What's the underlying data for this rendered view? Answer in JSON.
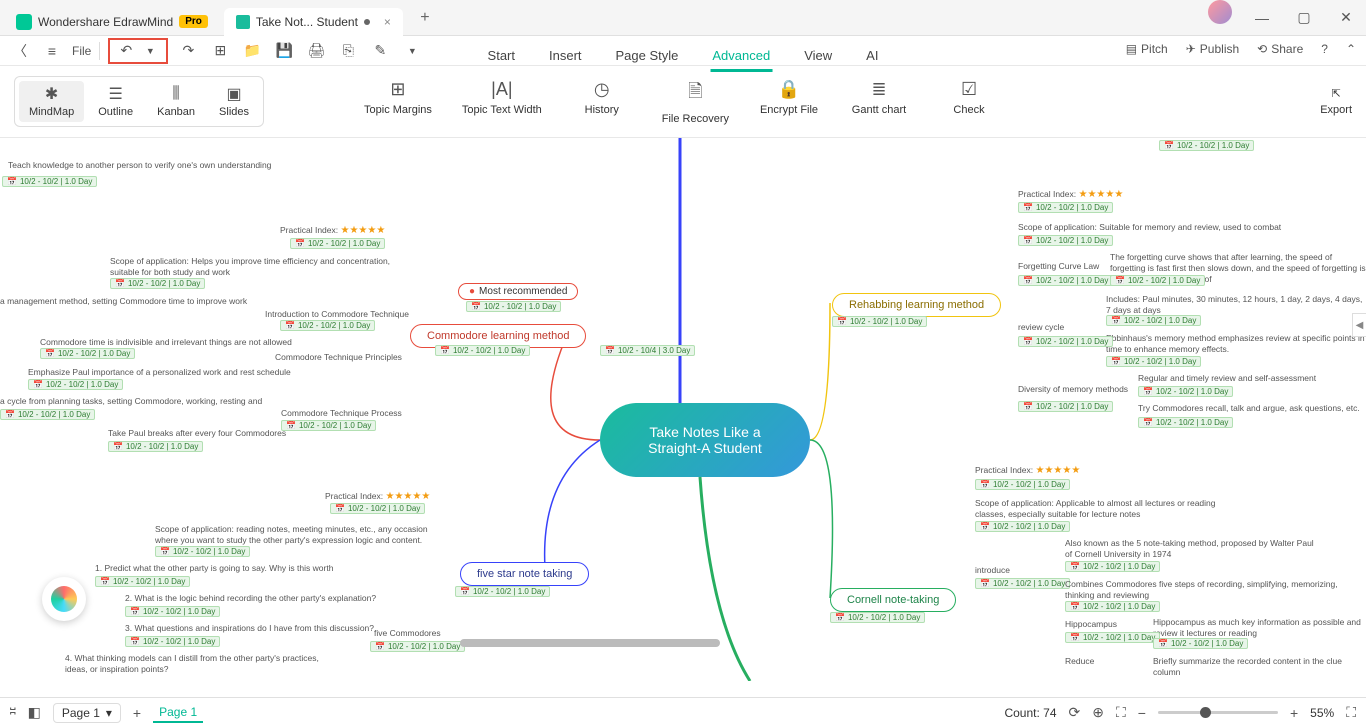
{
  "titlebar": {
    "app_name": "Wondershare EdrawMind",
    "pro": "Pro",
    "file_tab": "Take Not... Student"
  },
  "toolbar": {
    "file": "File"
  },
  "menu": {
    "start": "Start",
    "insert": "Insert",
    "pagestyle": "Page Style",
    "advanced": "Advanced",
    "view": "View",
    "ai": "AI"
  },
  "actions": {
    "pitch": "Pitch",
    "publish": "Publish",
    "share": "Share"
  },
  "views": {
    "mindmap": "MindMap",
    "outline": "Outline",
    "kanban": "Kanban",
    "slides": "Slides"
  },
  "ribbon": {
    "topic_margins": "Topic Margins",
    "topic_text_width": "Topic Text Width",
    "history": "History",
    "file_recovery": "File Recovery",
    "encrypt": "Encrypt File",
    "gantt": "Gantt chart",
    "check": "Check",
    "export": "Export"
  },
  "central": {
    "line1": "Take Notes Like a",
    "line2": "Straight-A Student"
  },
  "methods": {
    "commodore": "Commodore learning method",
    "fivestar": "five star note taking",
    "rehabbing": "Rehabbing learning method",
    "cornell": "Cornell note-taking"
  },
  "badge": "Most recommended",
  "labels": {
    "practical_index": "Practical Index:",
    "intro": "Introduction to Commodore Technique",
    "principles": "Commodore Technique Principles",
    "process": "Commodore Technique Process",
    "five_commodores": "five Commodores",
    "forgetting": "Forgetting Curve Law",
    "review_cycle": "review cycle",
    "diversity": "Diversity of memory methods",
    "introduce": "introduce",
    "hippocampus": "Hippocampus",
    "reduce": "Reduce"
  },
  "texts": {
    "teach": "Teach knowledge to another person to verify one's own understanding",
    "scope_commodore": "Scope of application: Helps you improve time efficiency and concentration, suitable for both study and work",
    "mgmt": "a management method, setting Commodore time to improve work",
    "indivisible": "Commodore time is indivisible and irrelevant things are not allowed",
    "emphasize": "Emphasize Paul importance of a personalized work and rest schedule",
    "cycle": "a cycle from planning tasks, setting Commodore, working, resting and reviewing",
    "breaks": "Take Paul breaks after every four Commodores",
    "scope_five": "Scope of application: reading notes, meeting minutes, etc., any occasion where you want to study the other party's expression logic and content.",
    "q1": "1. Predict what the other party is going to say. Why is this worth discussing?",
    "q2": "2. What is the logic behind recording the other party's explanation?",
    "q3": "3. What questions and inspirations do I have from this discussion?",
    "q4": "4. What thinking models can I distill from the other party's practices, ideas, or inspiration points?",
    "scope_rehab": "Scope of application: Suitable for memory and review, used to combat forgetfulness",
    "forget_desc": "The forgetting curve shows that after learning, the speed of forgetting is fast first then slows down, and the speed of forgetting is fastest in the early stage of",
    "includes": "Includes: Paul minutes, 30 minutes, 12 hours, 1 day, 2 days, 4 days, 7 days at days",
    "ebb": "Ebbinhaus's memory method emphasizes review at specific points in time to enhance memory effects.",
    "regular": "Regular and timely review and self-assessment",
    "try_comm": "Try Commodores recall, talk and argue, ask questions, etc.",
    "scope_cornell": "Scope of application: Applicable to almost all lectures or reading classes, especially suitable for lecture notes",
    "cornell_intro": "Also known as the 5 note-taking method, proposed by Walter Paul of Cornell University in 1974",
    "combines": "Combines Commodores five steps of recording, simplifying, memorizing, thinking and reviewing",
    "hippo_desc": "Hippocampus as much key information as possible and review it lectures or reading",
    "reduce_desc": "Briefly summarize the recorded content in the clue column"
  },
  "date_long": "10/2 - 10/4 | 3.0 Day",
  "date": "10/2 - 10/2 | 1.0 Day",
  "status": {
    "page_label": "Page 1",
    "page_tab": "Page 1",
    "count": "Count: 74",
    "zoom": "55%"
  }
}
